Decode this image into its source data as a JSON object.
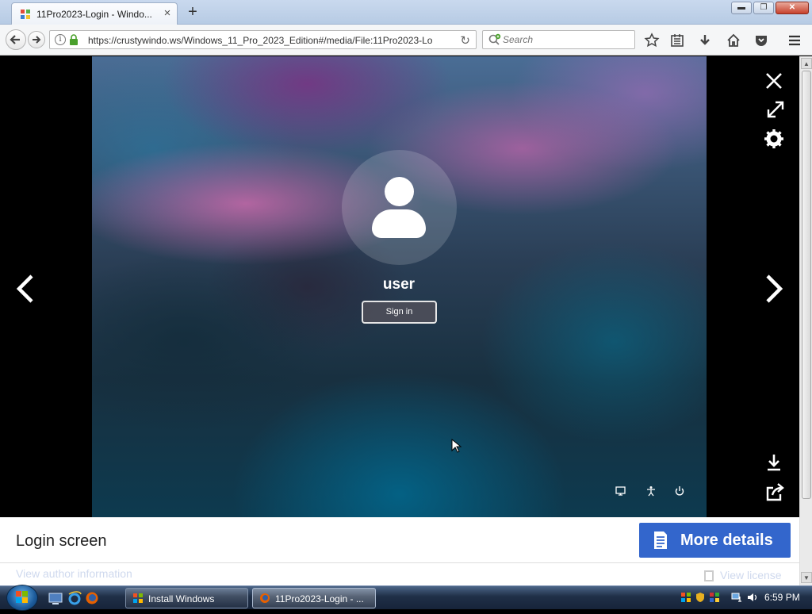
{
  "browser": {
    "tab": {
      "title": "11Pro2023-Login - Windo...",
      "close_label": "×"
    },
    "new_tab_label": "+",
    "window_buttons": {
      "minimize": "▬",
      "restore": "❐",
      "close": "✕"
    },
    "url": "https://crustywindo.ws/Windows_11_Pro_2023_Edition#/media/File:11Pro2023-Lo",
    "search": {
      "placeholder": "Search"
    }
  },
  "viewer": {
    "screenshot": {
      "username": "user",
      "sign_in_label": "Sign in"
    },
    "caption": {
      "title": "Login screen",
      "more_details_label": "More details",
      "author_link": "View author information",
      "license_link": "View license"
    }
  },
  "taskbar": {
    "buttons": [
      {
        "label": "Install Windows"
      },
      {
        "label": "11Pro2023-Login - ..."
      }
    ],
    "clock": "6:59 PM"
  },
  "colors": {
    "accent_button": "#3366cc",
    "viewer_background": "#000000",
    "taskbar": "#1f2f47"
  },
  "icons": [
    "back-icon",
    "forward-icon",
    "info-icon",
    "lock-icon",
    "reload-icon",
    "search-icon",
    "bookmark-star-icon",
    "reading-list-icon",
    "download-icon",
    "home-icon",
    "pocket-icon",
    "menu-icon",
    "close-icon",
    "fullscreen-icon",
    "gear-icon",
    "chevron-left-icon",
    "chevron-right-icon",
    "download-icon",
    "share-icon",
    "document-icon"
  ]
}
